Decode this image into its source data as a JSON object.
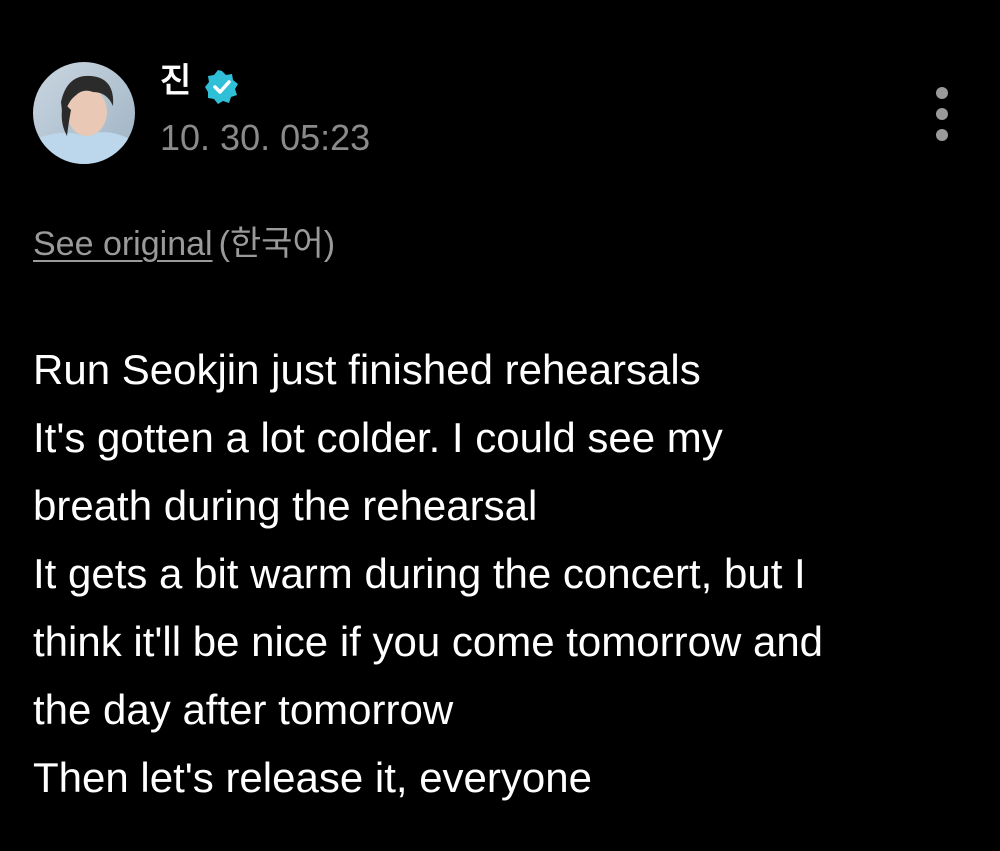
{
  "author": {
    "name": "진",
    "verified_icon": "verified-check-icon",
    "timestamp": "10. 30. 05:23",
    "avatar_icon": "profile-avatar"
  },
  "menu": {
    "icon": "more-vertical-icon"
  },
  "translation": {
    "see_original_label": "See original",
    "original_language": "(한국어)"
  },
  "post": {
    "lines": [
      "Run Seokjin just finished rehearsals",
      "It's gotten a lot colder. I could see my",
      "breath during the rehearsal",
      "It gets a bit warm during the concert, but I",
      "think it'll be nice if you come tomorrow and",
      "the day after tomorrow",
      "Then let's release it, everyone"
    ]
  },
  "colors": {
    "background": "#000000",
    "text": "#ffffff",
    "muted": "#8a8a8a",
    "verified": "#2fbfd6"
  }
}
